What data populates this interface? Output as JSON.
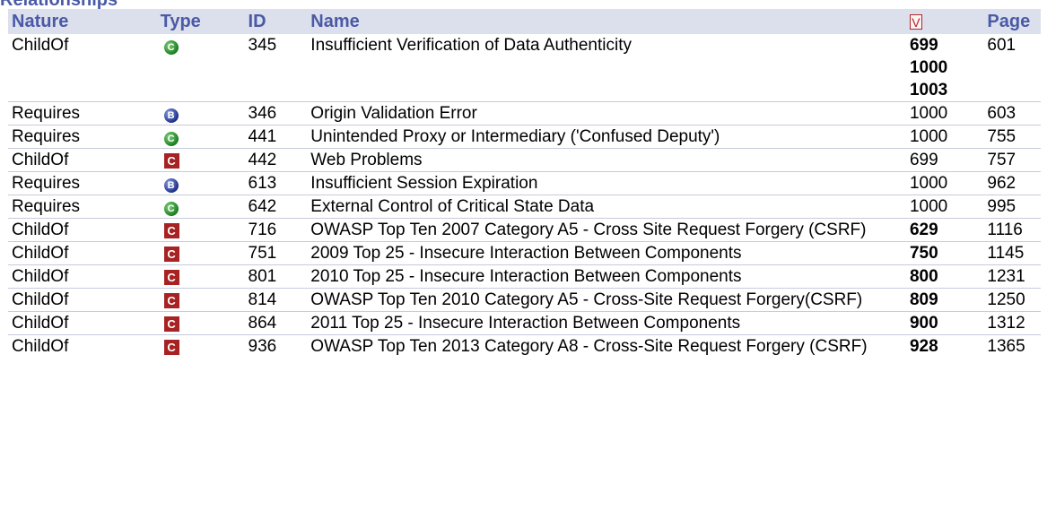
{
  "section": {
    "title": "Relationships"
  },
  "columns": {
    "nature": "Nature",
    "type": "Type",
    "id": "ID",
    "name": "Name",
    "v": "V",
    "page": "Page"
  },
  "icon_colors": {
    "category": "#a62223",
    "class": "#1c7d22",
    "base": "#1d2f86",
    "header_text": "#4a5aa6",
    "header_bg": "#dcdfec"
  },
  "rows": [
    {
      "nature": "ChildOf",
      "type_icon": "class-icon",
      "type_letter": "C",
      "id": "345",
      "name": "Insufficient Verification of Data Authenticity",
      "views": [
        "699",
        "1000",
        "1003"
      ],
      "views_bold": true,
      "page": "601"
    },
    {
      "nature": "Requires",
      "type_icon": "base-icon",
      "type_letter": "B",
      "id": "346",
      "name": "Origin Validation Error",
      "views": [
        "1000"
      ],
      "views_bold": false,
      "page": "603"
    },
    {
      "nature": "Requires",
      "type_icon": "class-icon",
      "type_letter": "C",
      "id": "441",
      "name": "Unintended Proxy or Intermediary ('Confused Deputy')",
      "views": [
        "1000"
      ],
      "views_bold": false,
      "page": "755"
    },
    {
      "nature": "ChildOf",
      "type_icon": "category-icon",
      "type_letter": "C",
      "id": "442",
      "name": "Web Problems",
      "views": [
        "699"
      ],
      "views_bold": false,
      "page": "757"
    },
    {
      "nature": "Requires",
      "type_icon": "base-icon",
      "type_letter": "B",
      "id": "613",
      "name": "Insufficient Session Expiration",
      "views": [
        "1000"
      ],
      "views_bold": false,
      "page": "962"
    },
    {
      "nature": "Requires",
      "type_icon": "class-icon",
      "type_letter": "C",
      "id": "642",
      "name": "External Control of Critical State Data",
      "views": [
        "1000"
      ],
      "views_bold": false,
      "page": "995"
    },
    {
      "nature": "ChildOf",
      "type_icon": "category-icon",
      "type_letter": "C",
      "id": "716",
      "name": "OWASP Top Ten 2007 Category A5 - Cross Site Request Forgery (CSRF)",
      "views": [
        "629"
      ],
      "views_bold": true,
      "page": "1116"
    },
    {
      "nature": "ChildOf",
      "type_icon": "category-icon",
      "type_letter": "C",
      "id": "751",
      "name": "2009 Top 25 - Insecure Interaction Between Components",
      "views": [
        "750"
      ],
      "views_bold": true,
      "page": "1145"
    },
    {
      "nature": "ChildOf",
      "type_icon": "category-icon",
      "type_letter": "C",
      "id": "801",
      "name": "2010 Top 25 - Insecure Interaction Between Components",
      "views": [
        "800"
      ],
      "views_bold": true,
      "page": "1231"
    },
    {
      "nature": "ChildOf",
      "type_icon": "category-icon",
      "type_letter": "C",
      "id": "814",
      "name": "OWASP Top Ten 2010 Category A5 - Cross-Site Request Forgery(CSRF)",
      "views": [
        "809"
      ],
      "views_bold": true,
      "page": "1250"
    },
    {
      "nature": "ChildOf",
      "type_icon": "category-icon",
      "type_letter": "C",
      "id": "864",
      "name": "2011 Top 25 - Insecure Interaction Between Components",
      "views": [
        "900"
      ],
      "views_bold": true,
      "page": "1312"
    },
    {
      "nature": "ChildOf",
      "type_icon": "category-icon",
      "type_letter": "C",
      "id": "936",
      "name": "OWASP Top Ten 2013 Category A8 - Cross-Site Request Forgery (CSRF)",
      "views": [
        "928"
      ],
      "views_bold": true,
      "page": "1365"
    }
  ]
}
